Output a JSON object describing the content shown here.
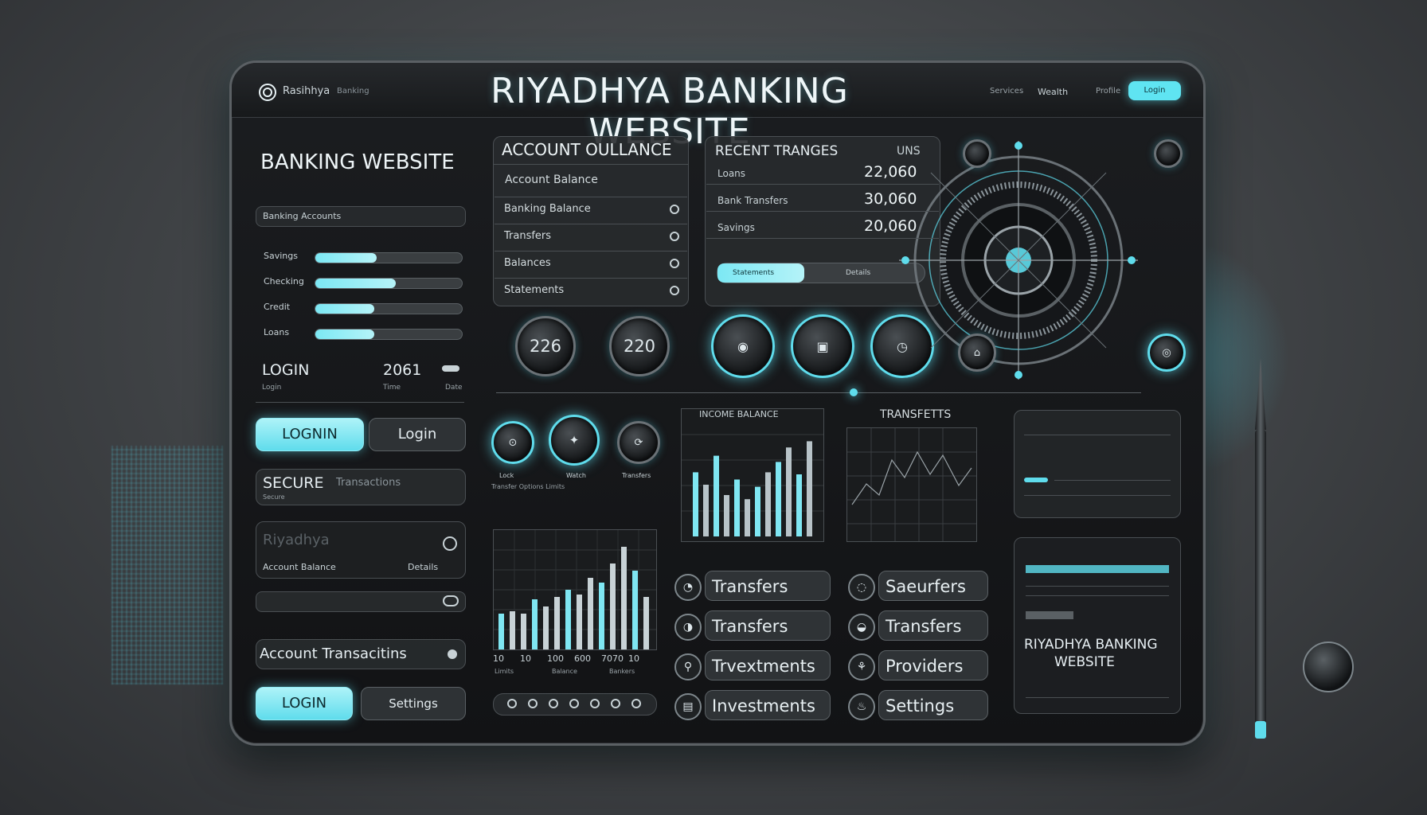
{
  "header": {
    "site_title": "RIYADHYA BANKING WEBSITE",
    "brand": "Rasihhya",
    "brand_sub": "Banking",
    "nav": [
      "Services",
      "Wealth",
      "Profile"
    ],
    "cta": "Login"
  },
  "sidebar": {
    "heading": "BANKING WEBSITE",
    "account_label": "Banking Accounts",
    "progress_items": [
      {
        "label": "Savings",
        "value": 0.42
      },
      {
        "label": "Checking",
        "value": 0.55
      },
      {
        "label": "Credit",
        "value": 0.4
      },
      {
        "label": "Loans",
        "value": 0.4
      }
    ],
    "login_label": "LOGIN",
    "login_value": "2061",
    "login_sub_left": "Login",
    "login_sub_mid": "Time",
    "login_sub_right": "Date",
    "login_btn_primary": "LOGNIN",
    "login_btn_secondary": "Login",
    "secure_label": "SECURE",
    "secure_sub": "Transactions",
    "secure_caption": "Secure",
    "blank_title": "Riyadhya",
    "blank_row": "Account Balance",
    "blank_row_right": "Details",
    "transactions_label": "Account Transacitins",
    "bottom_btn_primary": "LOGIN",
    "bottom_btn_secondary": "Settings"
  },
  "account_balance": {
    "title": "ACCOUNT OULLANCE",
    "subtitle": "Account Balance",
    "rows": [
      "Banking Balance",
      "Transfers",
      "Balances",
      "Statements"
    ]
  },
  "recent_transfers": {
    "title": "RECENT TRANGES",
    "title_right": "UNS",
    "rows": [
      {
        "label": "Loans",
        "value": "22,060"
      },
      {
        "label": "Bank Transfers",
        "value": "30,060"
      },
      {
        "label": "Savings",
        "value": "20,060"
      }
    ],
    "bar_label": "Statements",
    "bar_right": "Details",
    "bar_value": 0.42
  },
  "dials": {
    "value_1": "226",
    "value_2": "220"
  },
  "mini_controls": [
    "Lock",
    "Watch",
    "Transfers"
  ],
  "mini_caption": "Transfer Options Limits",
  "income_chart": {
    "title": "INCOME BALANCE"
  },
  "transfers_chart": {
    "title": "TRANSFETTS"
  },
  "main_chart": {
    "x_labels": [
      "10",
      "10",
      "100",
      "600",
      "7070",
      "10"
    ],
    "footer": [
      "Limits",
      "Balance",
      "Bankers"
    ]
  },
  "menu": {
    "left": [
      "Transfers",
      "Transfers",
      "Trvextments",
      "Investments"
    ],
    "right": [
      "Saeurfers",
      "Transfers",
      "Providers",
      "Settings"
    ]
  },
  "promo_card": {
    "title": "RIYADHYA BANKING",
    "title_2": "WEBSITE"
  },
  "colors": {
    "accent": "#5fdcec",
    "panel": "#282b2e",
    "background": "#3f4245"
  }
}
